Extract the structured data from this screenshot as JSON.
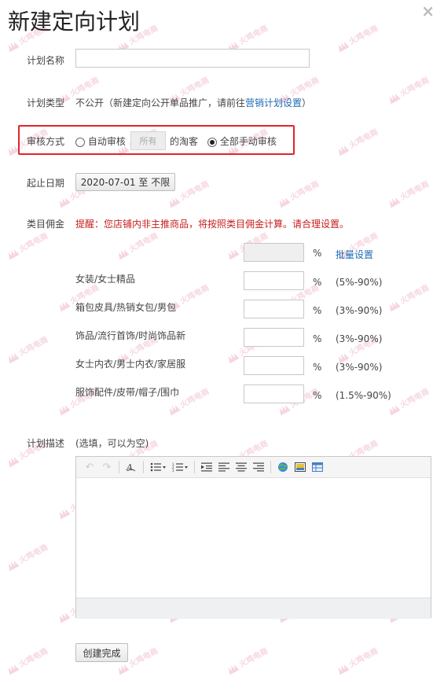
{
  "dialog": {
    "title": "新建定向计划",
    "close_label": "×"
  },
  "watermark": {
    "text": "火鸡电商"
  },
  "plan_name": {
    "label": "计划名称",
    "value": "",
    "placeholder": ""
  },
  "plan_type": {
    "label": "计划类型",
    "value_text": "不公开（新建定向公开单品推广，请前往",
    "link_text": "营销计划设置",
    "suffix": "）"
  },
  "review": {
    "label": "审核方式",
    "auto_label": "自动审核",
    "auto_select_value": "所有",
    "taoke_text": "的淘客",
    "manual_label": "全部手动审核",
    "selected": "manual"
  },
  "dates": {
    "label": "起止日期",
    "start": "2020-07-01",
    "sep": "至",
    "end": "不限"
  },
  "commission": {
    "label": "类目佣金",
    "warning": "提醒：您店铺内非主推商品，将按照类目佣金计算。请合理设置。",
    "batch": {
      "value": "",
      "unit": "%",
      "link": "批量设置"
    },
    "rows": [
      {
        "name": "女装/女士精品",
        "value": "",
        "unit": "%",
        "range": "(5%-90%)"
      },
      {
        "name": "箱包皮具/热销女包/男包",
        "value": "",
        "unit": "%",
        "range": "(3%-90%)"
      },
      {
        "name": "饰品/流行首饰/时尚饰品新",
        "value": "",
        "unit": "%",
        "range": "(3%-90%)"
      },
      {
        "name": "女士内衣/男士内衣/家居服",
        "value": "",
        "unit": "%",
        "range": "(3%-90%)"
      },
      {
        "name": "服饰配件/皮带/帽子/围巾",
        "value": "",
        "unit": "%",
        "range": "(1.5%-90%)"
      }
    ]
  },
  "description": {
    "label": "计划描述",
    "hint": "(选填，可以为空)"
  },
  "submit": {
    "label": "创建完成"
  }
}
